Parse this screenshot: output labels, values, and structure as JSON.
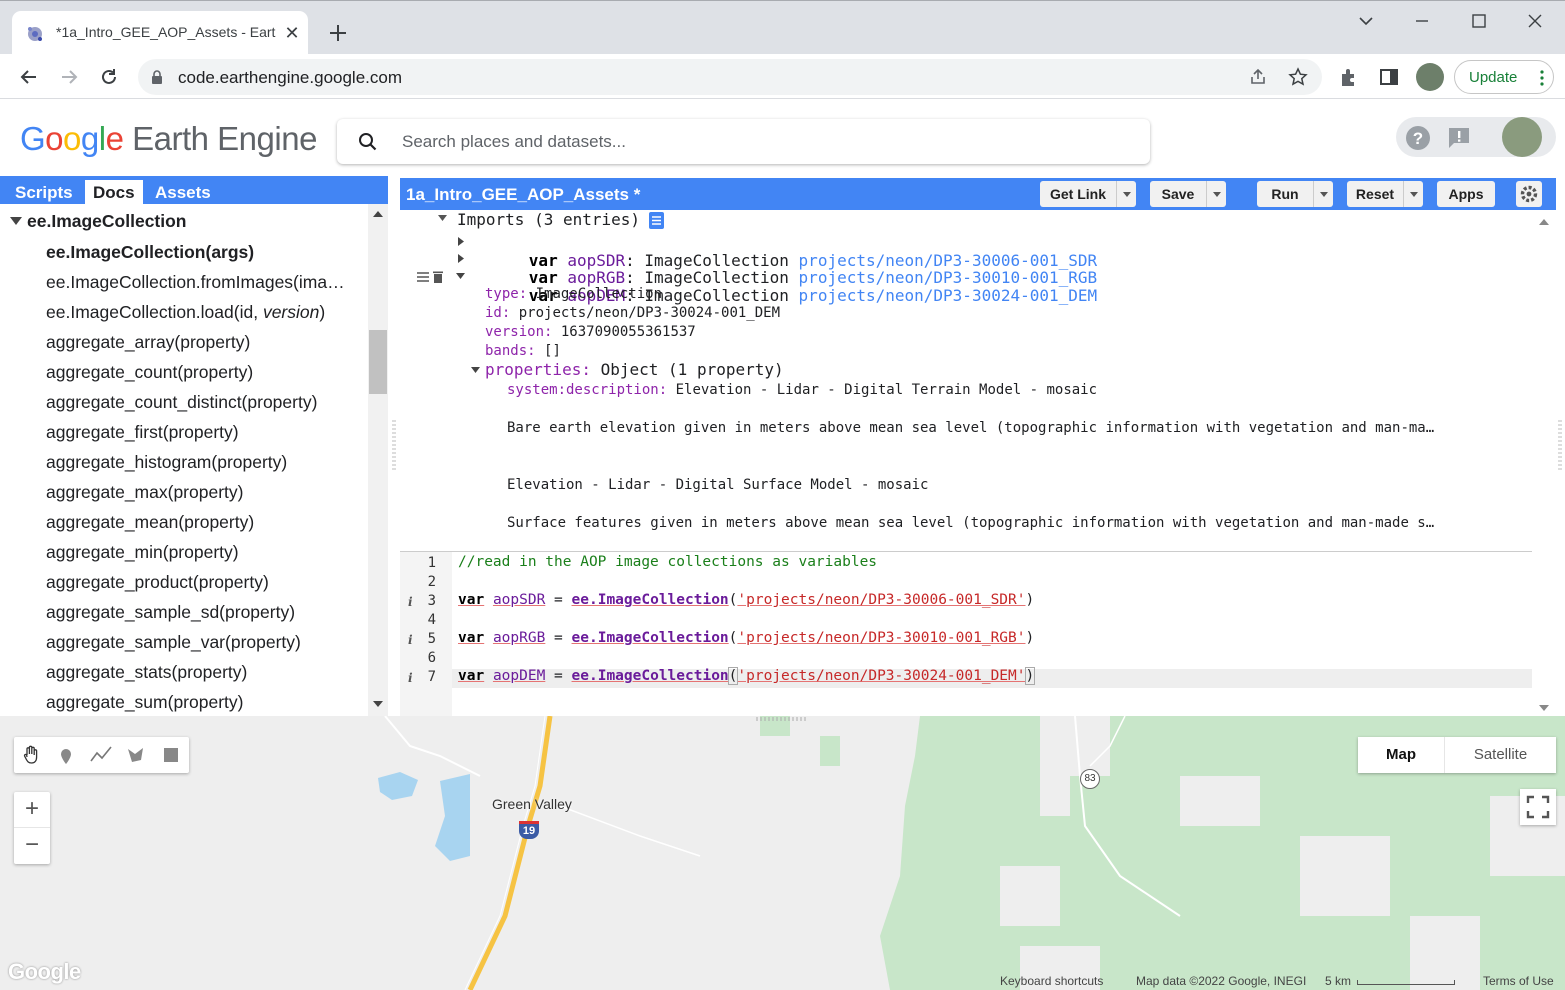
{
  "browser": {
    "tab_title": "*1a_Intro_GEE_AOP_Assets - Eart",
    "url": "code.earthengine.google.com",
    "update_label": "Update",
    "favicon": "earth-engine-favicon",
    "new_tab_icon": "plus-icon",
    "close_icon": "close-icon"
  },
  "header": {
    "logo_google": [
      "G",
      "o",
      "o",
      "g",
      "l",
      "e"
    ],
    "logo_product": "Earth Engine",
    "search_placeholder": "Search places and datasets..."
  },
  "left_panel": {
    "tabs": [
      "Scripts",
      "Docs",
      "Assets"
    ],
    "active_tab": "Docs",
    "tree_root": "ee.ImageCollection",
    "items": [
      "ee.ImageCollection(args)",
      "ee.ImageCollection.fromImages(ima…",
      "ee.ImageCollection.load(id, ",
      "aggregate_array(property)",
      "aggregate_count(property)",
      "aggregate_count_distinct(property)",
      "aggregate_first(property)",
      "aggregate_histogram(property)",
      "aggregate_max(property)",
      "aggregate_mean(property)",
      "aggregate_min(property)",
      "aggregate_product(property)",
      "aggregate_sample_sd(property)",
      "aggregate_sample_var(property)",
      "aggregate_stats(property)",
      "aggregate_sum(property)"
    ],
    "load_italic": "version",
    "load_close": ")"
  },
  "editor": {
    "title": "1a_Intro_GEE_AOP_Assets *",
    "buttons": {
      "get_link": "Get Link",
      "save": "Save",
      "run": "Run",
      "reset": "Reset",
      "apps": "Apps"
    },
    "imports": {
      "header": "Imports (3 entries)",
      "entries": [
        {
          "kw": "var",
          "name": "aopSDR",
          "type": "ImageCollection",
          "link": "projects/neon/DP3-30006-001_SDR"
        },
        {
          "kw": "var",
          "name": "aopRGB",
          "type": "ImageCollection",
          "link": "projects/neon/DP3-30010-001_RGB"
        },
        {
          "kw": "var",
          "name": "aopDEM",
          "type": "ImageCollection",
          "link": "projects/neon/DP3-30024-001_DEM"
        }
      ],
      "details": {
        "type_key": "type:",
        "type_val": "ImageCollection",
        "id_key": "id:",
        "id_val": "projects/neon/DP3-30024-001_DEM",
        "version_key": "version:",
        "version_val": "1637090055361537",
        "bands_key": "bands:",
        "bands_val": "[]",
        "props_key": "properties:",
        "props_val": "Object (1 property)",
        "sysdesc_key": "system:description:",
        "sysdesc_val": "Elevation - Lidar - Digital Terrain Model - mosaic",
        "para1": "Bare earth elevation given in meters above mean sea level (topographic information with vegetation and man-ma…",
        "para2": "Elevation - Lidar - Digital Surface Model - mosaic",
        "para3": "Surface features given in meters above mean sea level (topographic information with vegetation and man-made s…"
      }
    },
    "code_lines": [
      "1",
      "2",
      "3",
      "4",
      "5",
      "6",
      "7"
    ],
    "code": {
      "comment": "//read in the AOP image collections as variables",
      "lines": [
        {
          "kw": "var",
          "name": "aopSDR",
          "eq": " = ",
          "fn": "ee.ImageCollection",
          "open": "(",
          "str": "'projects/neon/DP3-30006-001_SDR'",
          "close": ")"
        },
        {
          "kw": "var",
          "name": "aopRGB",
          "eq": " = ",
          "fn": "ee.ImageCollection",
          "open": "(",
          "str": "'projects/neon/DP3-30010-001_RGB'",
          "close": ")"
        },
        {
          "kw": "var",
          "name": "aopDEM",
          "eq": " = ",
          "fn": "ee.ImageCollection",
          "open": "(",
          "str": "'projects/neon/DP3-30024-001_DEM'",
          "close": ")"
        }
      ],
      "info_icon": "i"
    }
  },
  "map": {
    "place_label": "Green Valley",
    "highway_1": "19",
    "highway_2": "83",
    "type_options": [
      "Map",
      "Satellite"
    ],
    "selected_type": "Map",
    "zoom_in": "+",
    "zoom_out": "−",
    "google_watermark": "Google",
    "attribution": [
      "Keyboard shortcuts",
      "Map data ©2022 Google, INEGI",
      "5 km",
      "Terms of Use"
    ],
    "colors": {
      "base": "#eeeeee",
      "forest": "#c8e6c9",
      "water": "#a8d4f0",
      "road": "#f6c343"
    }
  }
}
